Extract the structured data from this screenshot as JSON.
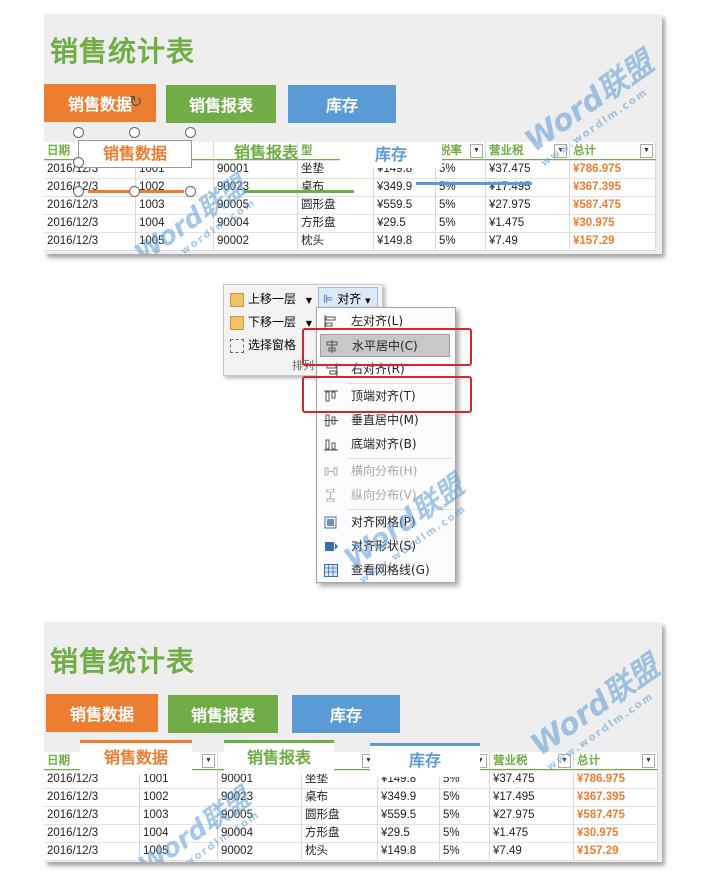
{
  "colors": {
    "orange": "#ed7d31",
    "green": "#70ad47",
    "blue": "#5b9bd5",
    "title_green": "#70ad47",
    "red_box": "#d9232d"
  },
  "sheet_top": {
    "title": "销售统计表",
    "buttons": [
      "销售数据",
      "销售报表",
      "库存"
    ],
    "headers": [
      "日期",
      "",
      "",
      "",
      "",
      "税率",
      "营业税",
      "总计"
    ],
    "header_partial": "型",
    "rows": [
      [
        "2016/12/3",
        "1001",
        "90001",
        "坐垫",
        "¥149.8",
        "5%",
        "¥37.475",
        "¥786.975"
      ],
      [
        "2016/12/3",
        "1002",
        "90023",
        "桌布",
        "¥349.9",
        "5%",
        "¥17.495",
        "¥367.395"
      ],
      [
        "2016/12/3",
        "1003",
        "90005",
        "圆形盘",
        "¥559.5",
        "5%",
        "¥27.975",
        "¥587.475"
      ],
      [
        "2016/12/3",
        "1004",
        "90004",
        "方形盘",
        "¥29.5",
        "5%",
        "¥1.475",
        "¥30.975"
      ],
      [
        "2016/12/3",
        "1005",
        "90002",
        "枕头",
        "¥149.8",
        "5%",
        "¥7.49",
        "¥157.29"
      ]
    ],
    "shapes": [
      "销售数据",
      "销售报表",
      "库存"
    ]
  },
  "ribbon": {
    "bring_forward": "上移一层",
    "send_backward": "下移一层",
    "selection_pane": "选择窗格",
    "align": "对齐",
    "group_label": "排列"
  },
  "menu": {
    "items": [
      {
        "label": "左对齐(L)",
        "icon": "align-left-icon",
        "disabled": false
      },
      {
        "label": "水平居中(C)",
        "icon": "align-center-icon",
        "disabled": false,
        "highlight": true
      },
      {
        "label": "右对齐(R)",
        "icon": "align-right-icon",
        "disabled": false
      },
      {
        "label": "顶端对齐(T)",
        "icon": "align-top-icon",
        "disabled": false
      },
      {
        "label": "垂直居中(M)",
        "icon": "align-middle-icon",
        "disabled": false
      },
      {
        "label": "底端对齐(B)",
        "icon": "align-bottom-icon",
        "disabled": false
      },
      {
        "label": "横向分布(H)",
        "icon": "distribute-horizontal-icon",
        "disabled": true
      },
      {
        "label": "纵向分布(V)",
        "icon": "distribute-vertical-icon",
        "disabled": true
      },
      {
        "label": "对齐网格(P)",
        "icon": "snap-grid-icon",
        "disabled": false
      },
      {
        "label": "对齐形状(S)",
        "icon": "snap-shape-icon",
        "disabled": false
      },
      {
        "label": "查看网格线(G)",
        "icon": "view-gridlines-icon",
        "disabled": false
      }
    ]
  },
  "sheet_bottom": {
    "title": "销售统计表",
    "buttons": [
      "销售数据",
      "销售报表",
      "库存"
    ],
    "headers": [
      "日期",
      "",
      "",
      "",
      "",
      "",
      "营业税",
      "总计"
    ],
    "rows": [
      [
        "2016/12/3",
        "1001",
        "90001",
        "坐垫",
        "¥149.8",
        "5%",
        "¥37.475",
        "¥786.975"
      ],
      [
        "2016/12/3",
        "1002",
        "90023",
        "桌布",
        "¥349.9",
        "5%",
        "¥17.495",
        "¥367.395"
      ],
      [
        "2016/12/3",
        "1003",
        "90005",
        "圆形盘",
        "¥559.5",
        "5%",
        "¥27.975",
        "¥587.475"
      ],
      [
        "2016/12/3",
        "1004",
        "90004",
        "方形盘",
        "¥29.5",
        "5%",
        "¥1.475",
        "¥30.975"
      ],
      [
        "2016/12/3",
        "1005",
        "90002",
        "枕头",
        "¥149.8",
        "5%",
        "¥7.49",
        "¥157.29"
      ]
    ],
    "shapes": [
      "销售数据",
      "销售报表",
      "库存"
    ]
  },
  "watermark": {
    "brand": "Word联盟",
    "site": "www.wordlm.com"
  }
}
